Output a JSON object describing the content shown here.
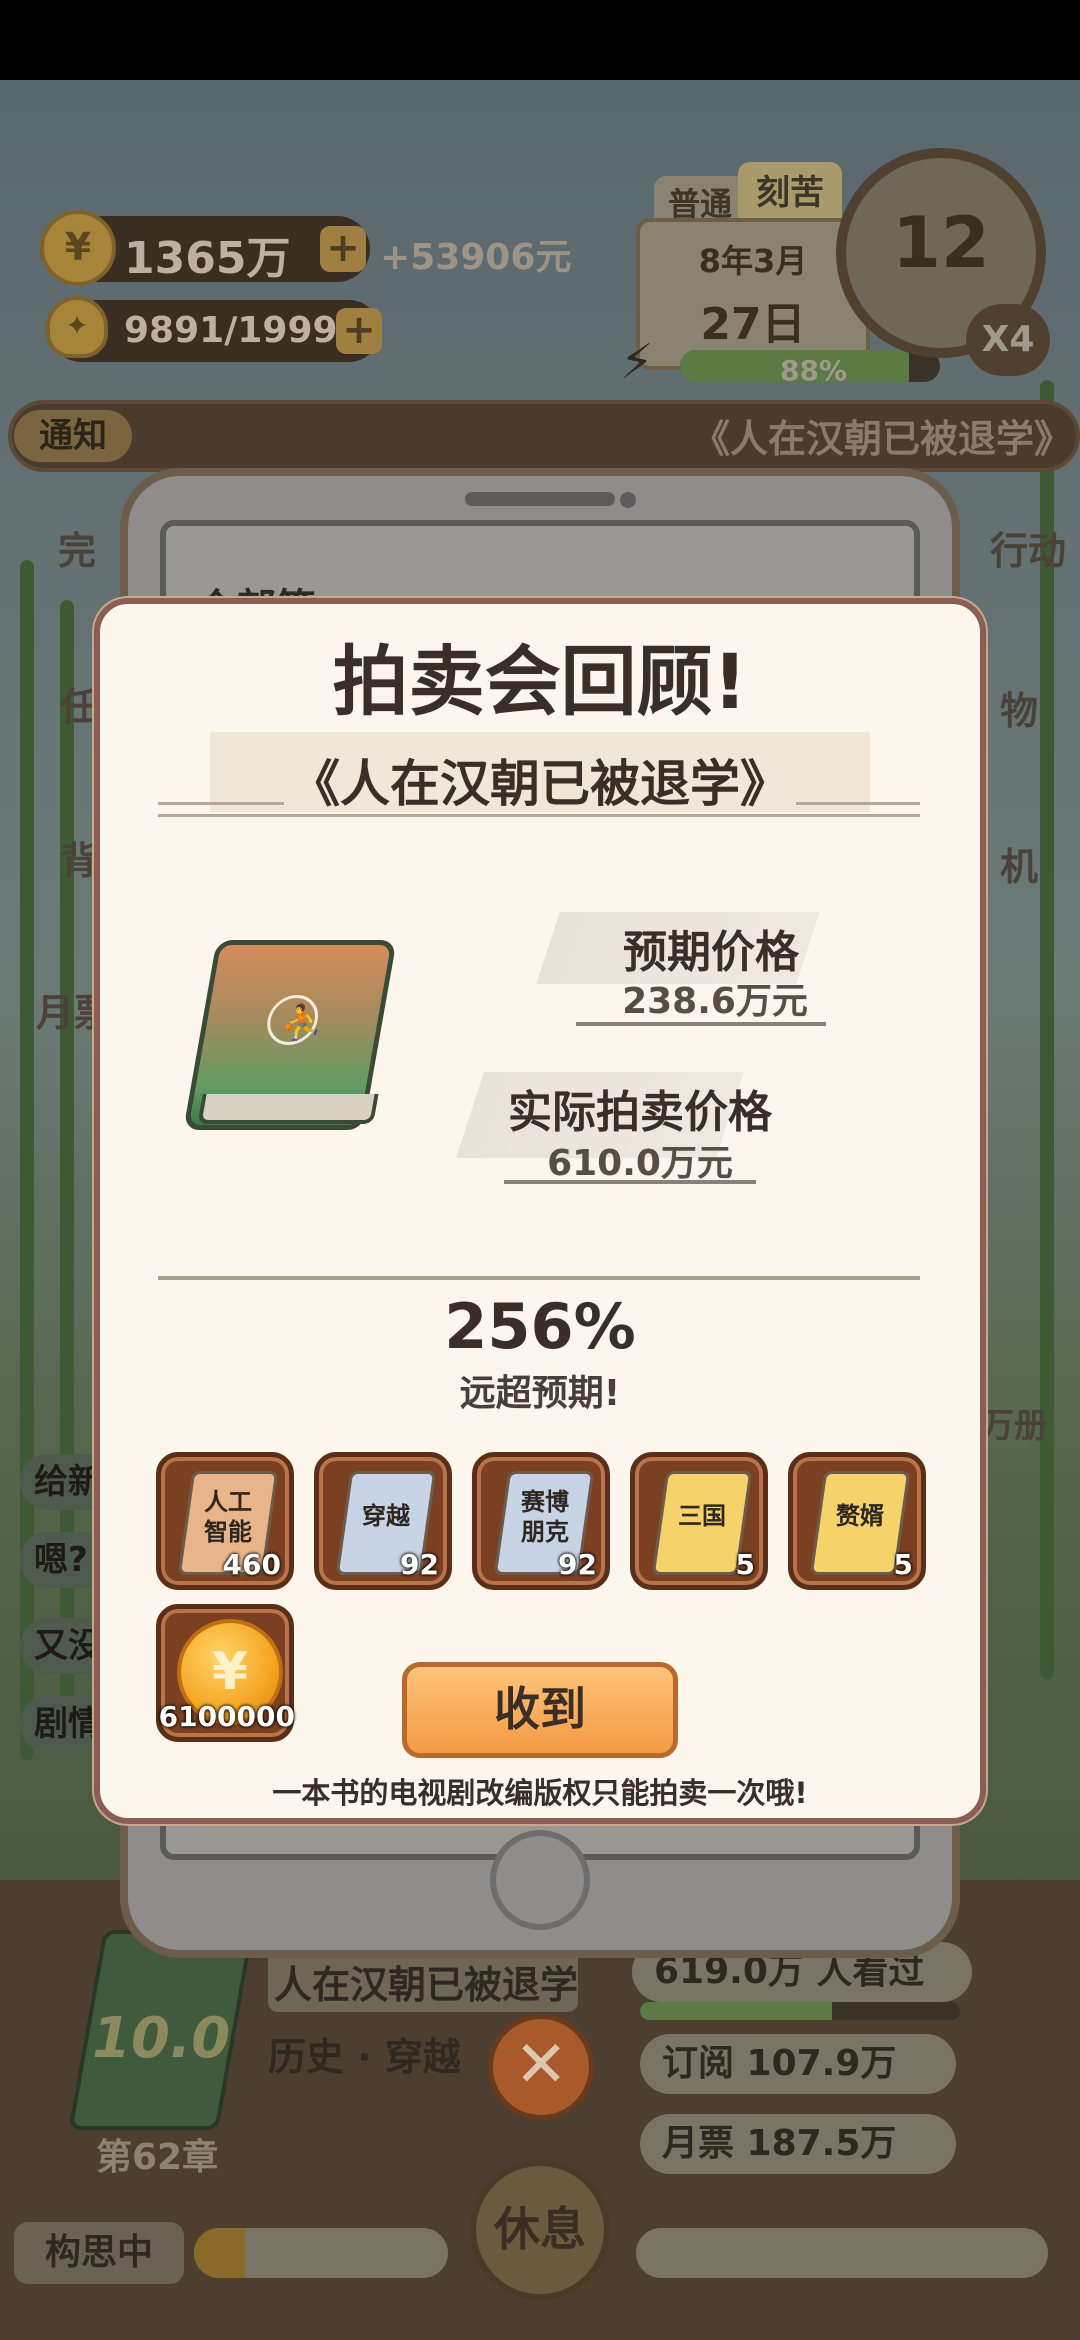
{
  "hud": {
    "money": "1365万",
    "money_delta": "+53906元",
    "energy": "9891/19999",
    "mode_normal": "普通",
    "mode_hard": "刻苦",
    "date_month": "8年3月",
    "date_day": "27日",
    "progress": "88%",
    "progress_value": 0.88,
    "clock_hour": "12",
    "speed": "X4"
  },
  "notice": {
    "tag": "通知",
    "text": "《人在汉朝已被退学》"
  },
  "background": {
    "phone_header": "个部签",
    "side_left": [
      "完",
      "任",
      "背",
      "月票"
    ],
    "side_right": [
      "行动",
      "物",
      "机"
    ],
    "shelf_count": "万册",
    "chat_items": [
      "给新",
      "嗯?",
      "又没",
      "剧情"
    ]
  },
  "bottom": {
    "book_name": "人在汉朝已被退学",
    "genre": "历史 · 穿越",
    "chapter": "第62章",
    "score": "10.0",
    "views": "619.0万 人看过",
    "subscribe": "订阅  107.9万",
    "monthly": "月票  187.5万",
    "status": "构思中",
    "rest": "休息"
  },
  "modal": {
    "title": "拍卖会回顾!",
    "book_title": "《人在汉朝已被退学》",
    "expected_label": "预期价格",
    "expected_value": "238.6万元",
    "actual_label": "实际拍卖价格",
    "actual_value": "610.0万元",
    "percent": "256%",
    "percent_note": "远超预期!",
    "rewards": [
      {
        "label": "人工智能",
        "count": "460",
        "color": "#e9b48a"
      },
      {
        "label": "穿越",
        "count": "92",
        "color": "#c9d3e6"
      },
      {
        "label": "赛博朋克",
        "count": "92",
        "color": "#c9d3e6"
      },
      {
        "label": "三国",
        "count": "5",
        "color": "#f6d36a"
      },
      {
        "label": "赘婿",
        "count": "5",
        "color": "#f6d36a"
      }
    ],
    "coin_reward": {
      "icon": "yen-coin-icon",
      "glyph": "¥",
      "count": "6100000"
    },
    "receive_button": "收到",
    "footer_note": "一本书的电视剧改编版权只能拍卖一次哦!"
  }
}
